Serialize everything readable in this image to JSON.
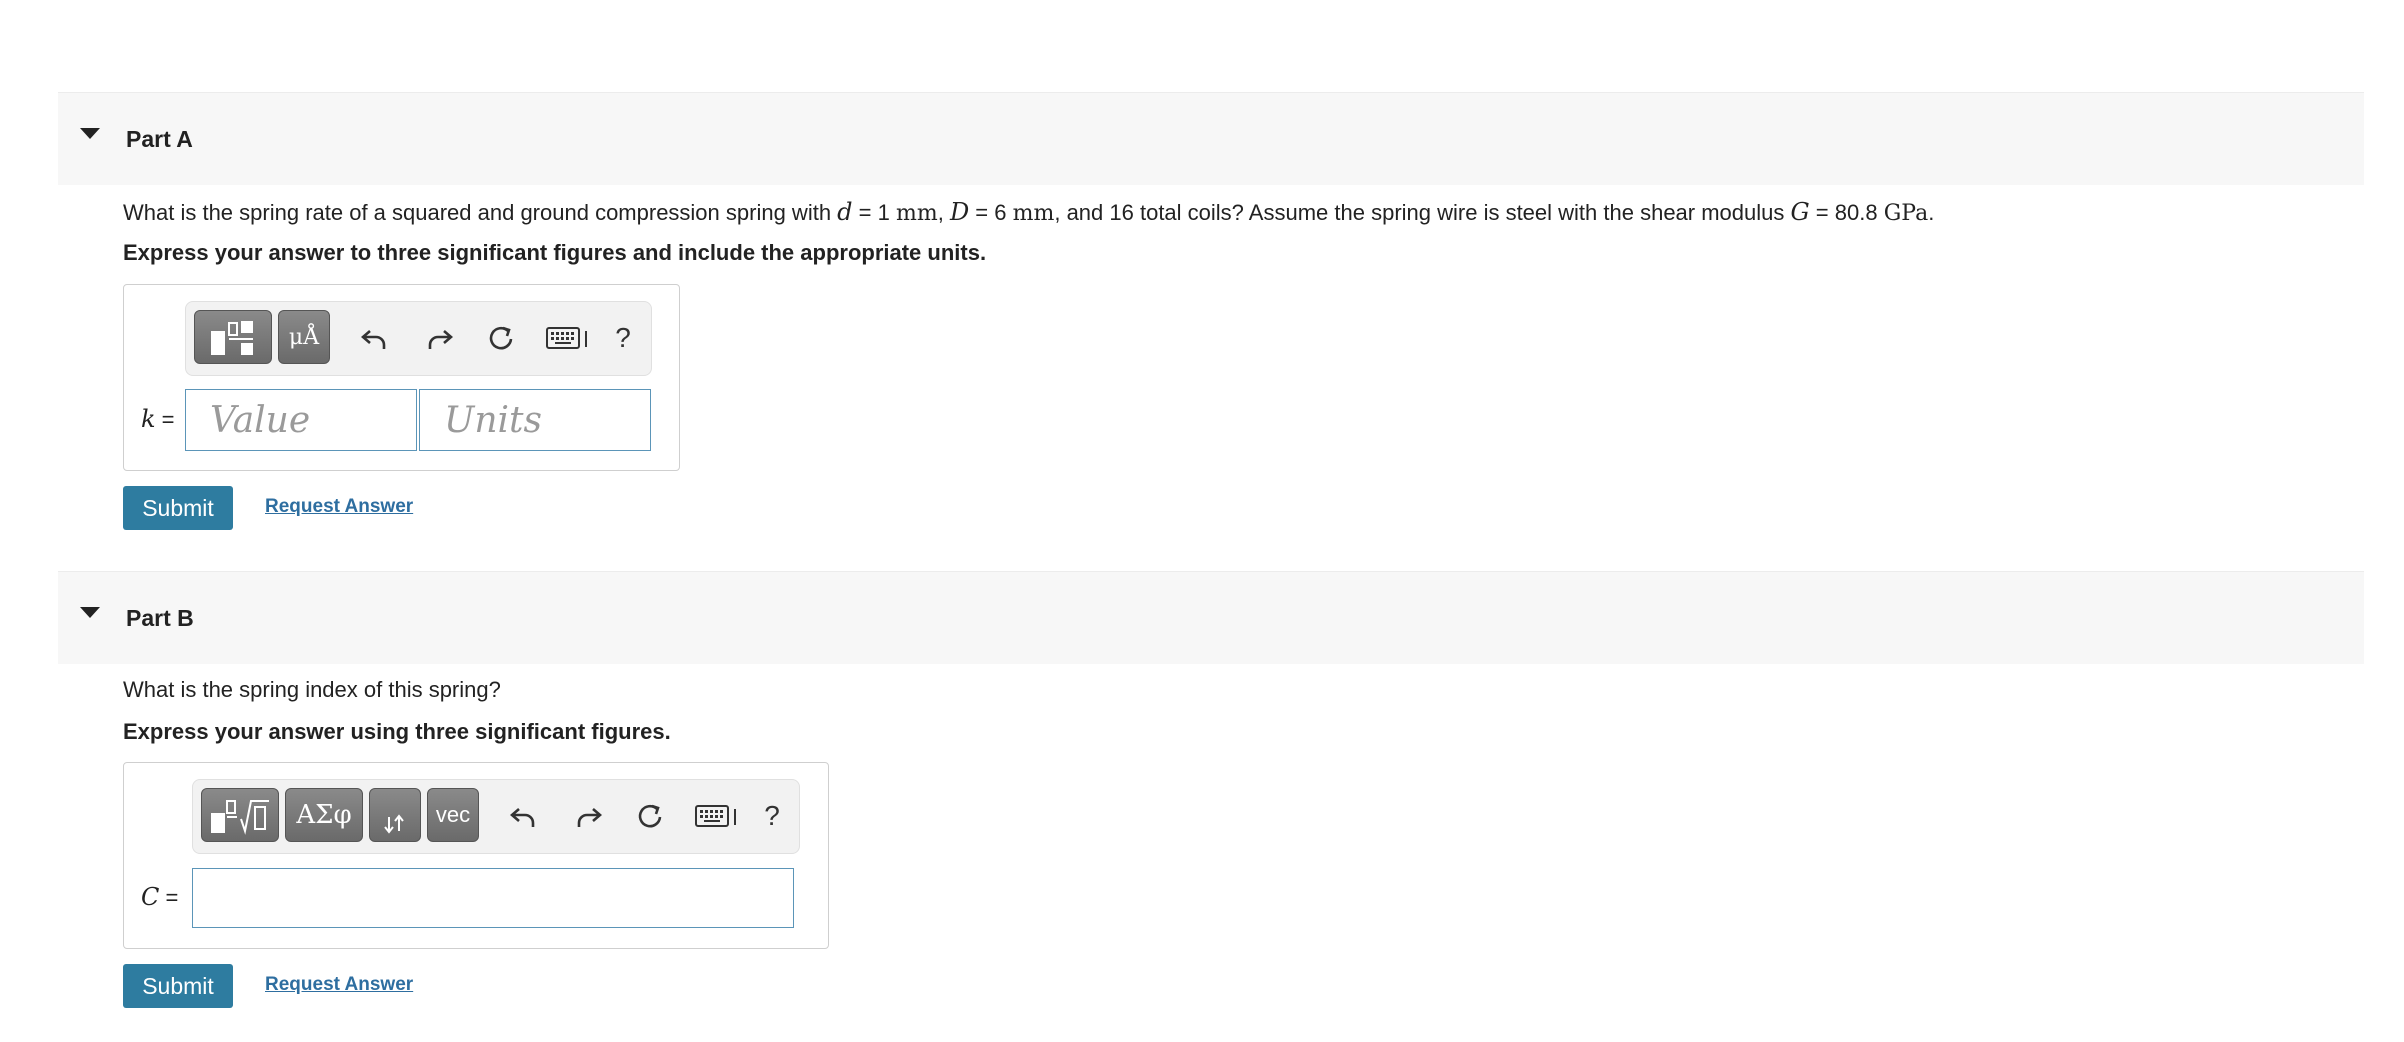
{
  "partA": {
    "title": "Part A",
    "q1": "What is the spring rate of a squared and ground compression spring with ",
    "d_var": "d",
    "q2": " = 1 ",
    "mm1": "mm",
    "q3": ", ",
    "D_var": "D",
    "q4": " = 6 ",
    "mm2": "mm",
    "q5": ", and 16 total coils? Assume the spring wire is steel with the shear modulus ",
    "G_var": "G",
    "q6": " = 80.8 ",
    "gpa": "GPa",
    "q7": ".",
    "instruction": "Express your answer to three significant figures and include the appropriate units.",
    "toolbar": {
      "button1_icon": "templates-icon",
      "button2_label": "μÅ"
    },
    "var_name": "k",
    "equals": " =",
    "value_placeholder": "Value",
    "units_placeholder": "Units",
    "submit_label": "Submit",
    "request_label": "Request Answer"
  },
  "partB": {
    "title": "Part B",
    "question": "What is the spring index of this spring?",
    "instruction": "Express your answer using three significant figures.",
    "toolbar": {
      "button1_icon": "fraction-sqrt-icon",
      "button2_label": "ΑΣφ",
      "button3_icon": "subscript-arrows-icon",
      "button4_label": "vec"
    },
    "var_name": "C",
    "equals": " =",
    "input_value": "",
    "submit_label": "Submit",
    "request_label": "Request Answer"
  },
  "toolbar_common": {
    "help_label": "?"
  }
}
